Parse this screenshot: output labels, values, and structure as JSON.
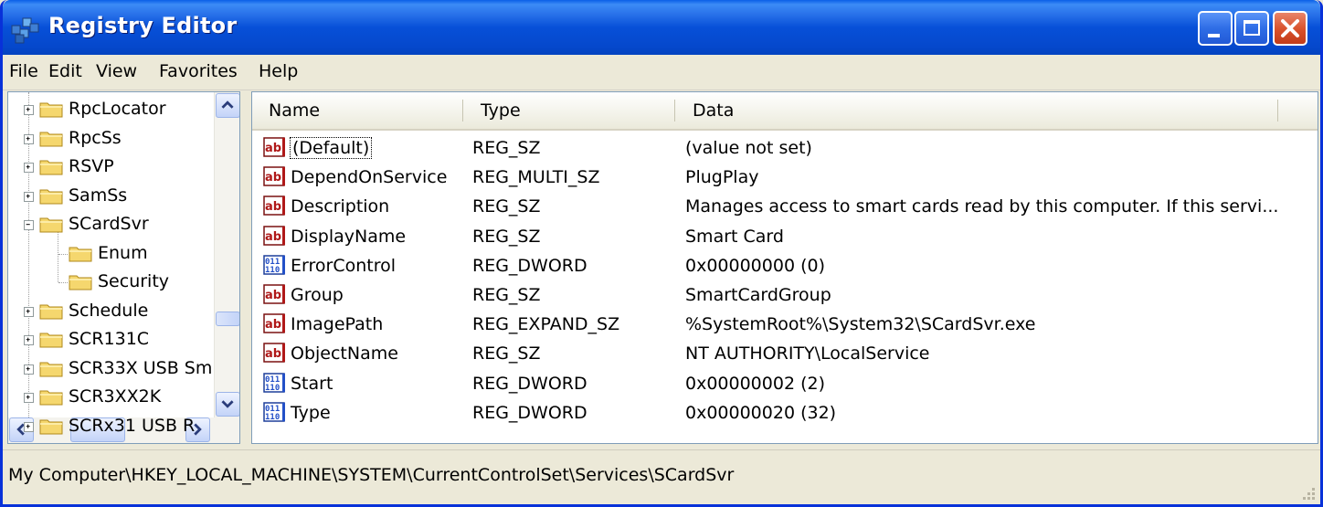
{
  "window": {
    "title": "Registry Editor"
  },
  "menu": {
    "file": "File",
    "edit": "Edit",
    "view": "View",
    "favorites": "Favorites",
    "help": "Help"
  },
  "tree": {
    "items": [
      {
        "label": "RpcLocator",
        "expander": "+"
      },
      {
        "label": "RpcSs",
        "expander": "+"
      },
      {
        "label": "RSVP",
        "expander": "+"
      },
      {
        "label": "SamSs",
        "expander": "+"
      },
      {
        "label": "SCardSvr",
        "expander": "-"
      },
      {
        "label": "Enum",
        "expander": ""
      },
      {
        "label": "Security",
        "expander": ""
      },
      {
        "label": "Schedule",
        "expander": "+"
      },
      {
        "label": "SCR131C",
        "expander": "+"
      },
      {
        "label": "SCR33X USB Sm",
        "expander": "+"
      },
      {
        "label": "SCR3XX2K",
        "expander": "+"
      },
      {
        "label": "SCRx31 USB R",
        "expander": "+"
      }
    ]
  },
  "list": {
    "columns": {
      "name": "Name",
      "type": "Type",
      "data": "Data"
    },
    "rows": [
      {
        "name": "(Default)",
        "type": "REG_SZ",
        "data": "(value not set)",
        "icon": "string-value-icon"
      },
      {
        "name": "DependOnService",
        "type": "REG_MULTI_SZ",
        "data": "PlugPlay",
        "icon": "string-value-icon"
      },
      {
        "name": "Description",
        "type": "REG_SZ",
        "data": "Manages access to smart cards read by this computer. If this servi...",
        "icon": "string-value-icon"
      },
      {
        "name": "DisplayName",
        "type": "REG_SZ",
        "data": "Smart Card",
        "icon": "string-value-icon"
      },
      {
        "name": "ErrorControl",
        "type": "REG_DWORD",
        "data": "0x00000000 (0)",
        "icon": "binary-value-icon"
      },
      {
        "name": "Group",
        "type": "REG_SZ",
        "data": "SmartCardGroup",
        "icon": "string-value-icon"
      },
      {
        "name": "ImagePath",
        "type": "REG_EXPAND_SZ",
        "data": "%SystemRoot%\\System32\\SCardSvr.exe",
        "icon": "string-value-icon"
      },
      {
        "name": "ObjectName",
        "type": "REG_SZ",
        "data": "NT AUTHORITY\\LocalService",
        "icon": "string-value-icon"
      },
      {
        "name": "Start",
        "type": "REG_DWORD",
        "data": "0x00000002 (2)",
        "icon": "binary-value-icon"
      },
      {
        "name": "Type",
        "type": "REG_DWORD",
        "data": "0x00000020 (32)",
        "icon": "binary-value-icon"
      }
    ]
  },
  "statusbar": {
    "path": "My Computer\\HKEY_LOCAL_MACHINE\\SYSTEM\\CurrentControlSet\\Services\\SCardSvr"
  },
  "colors": {
    "titlebar": "#0550d8",
    "close_button": "#d8502a",
    "window_bg": "#ece9d8",
    "folder": "#f5d76e"
  }
}
